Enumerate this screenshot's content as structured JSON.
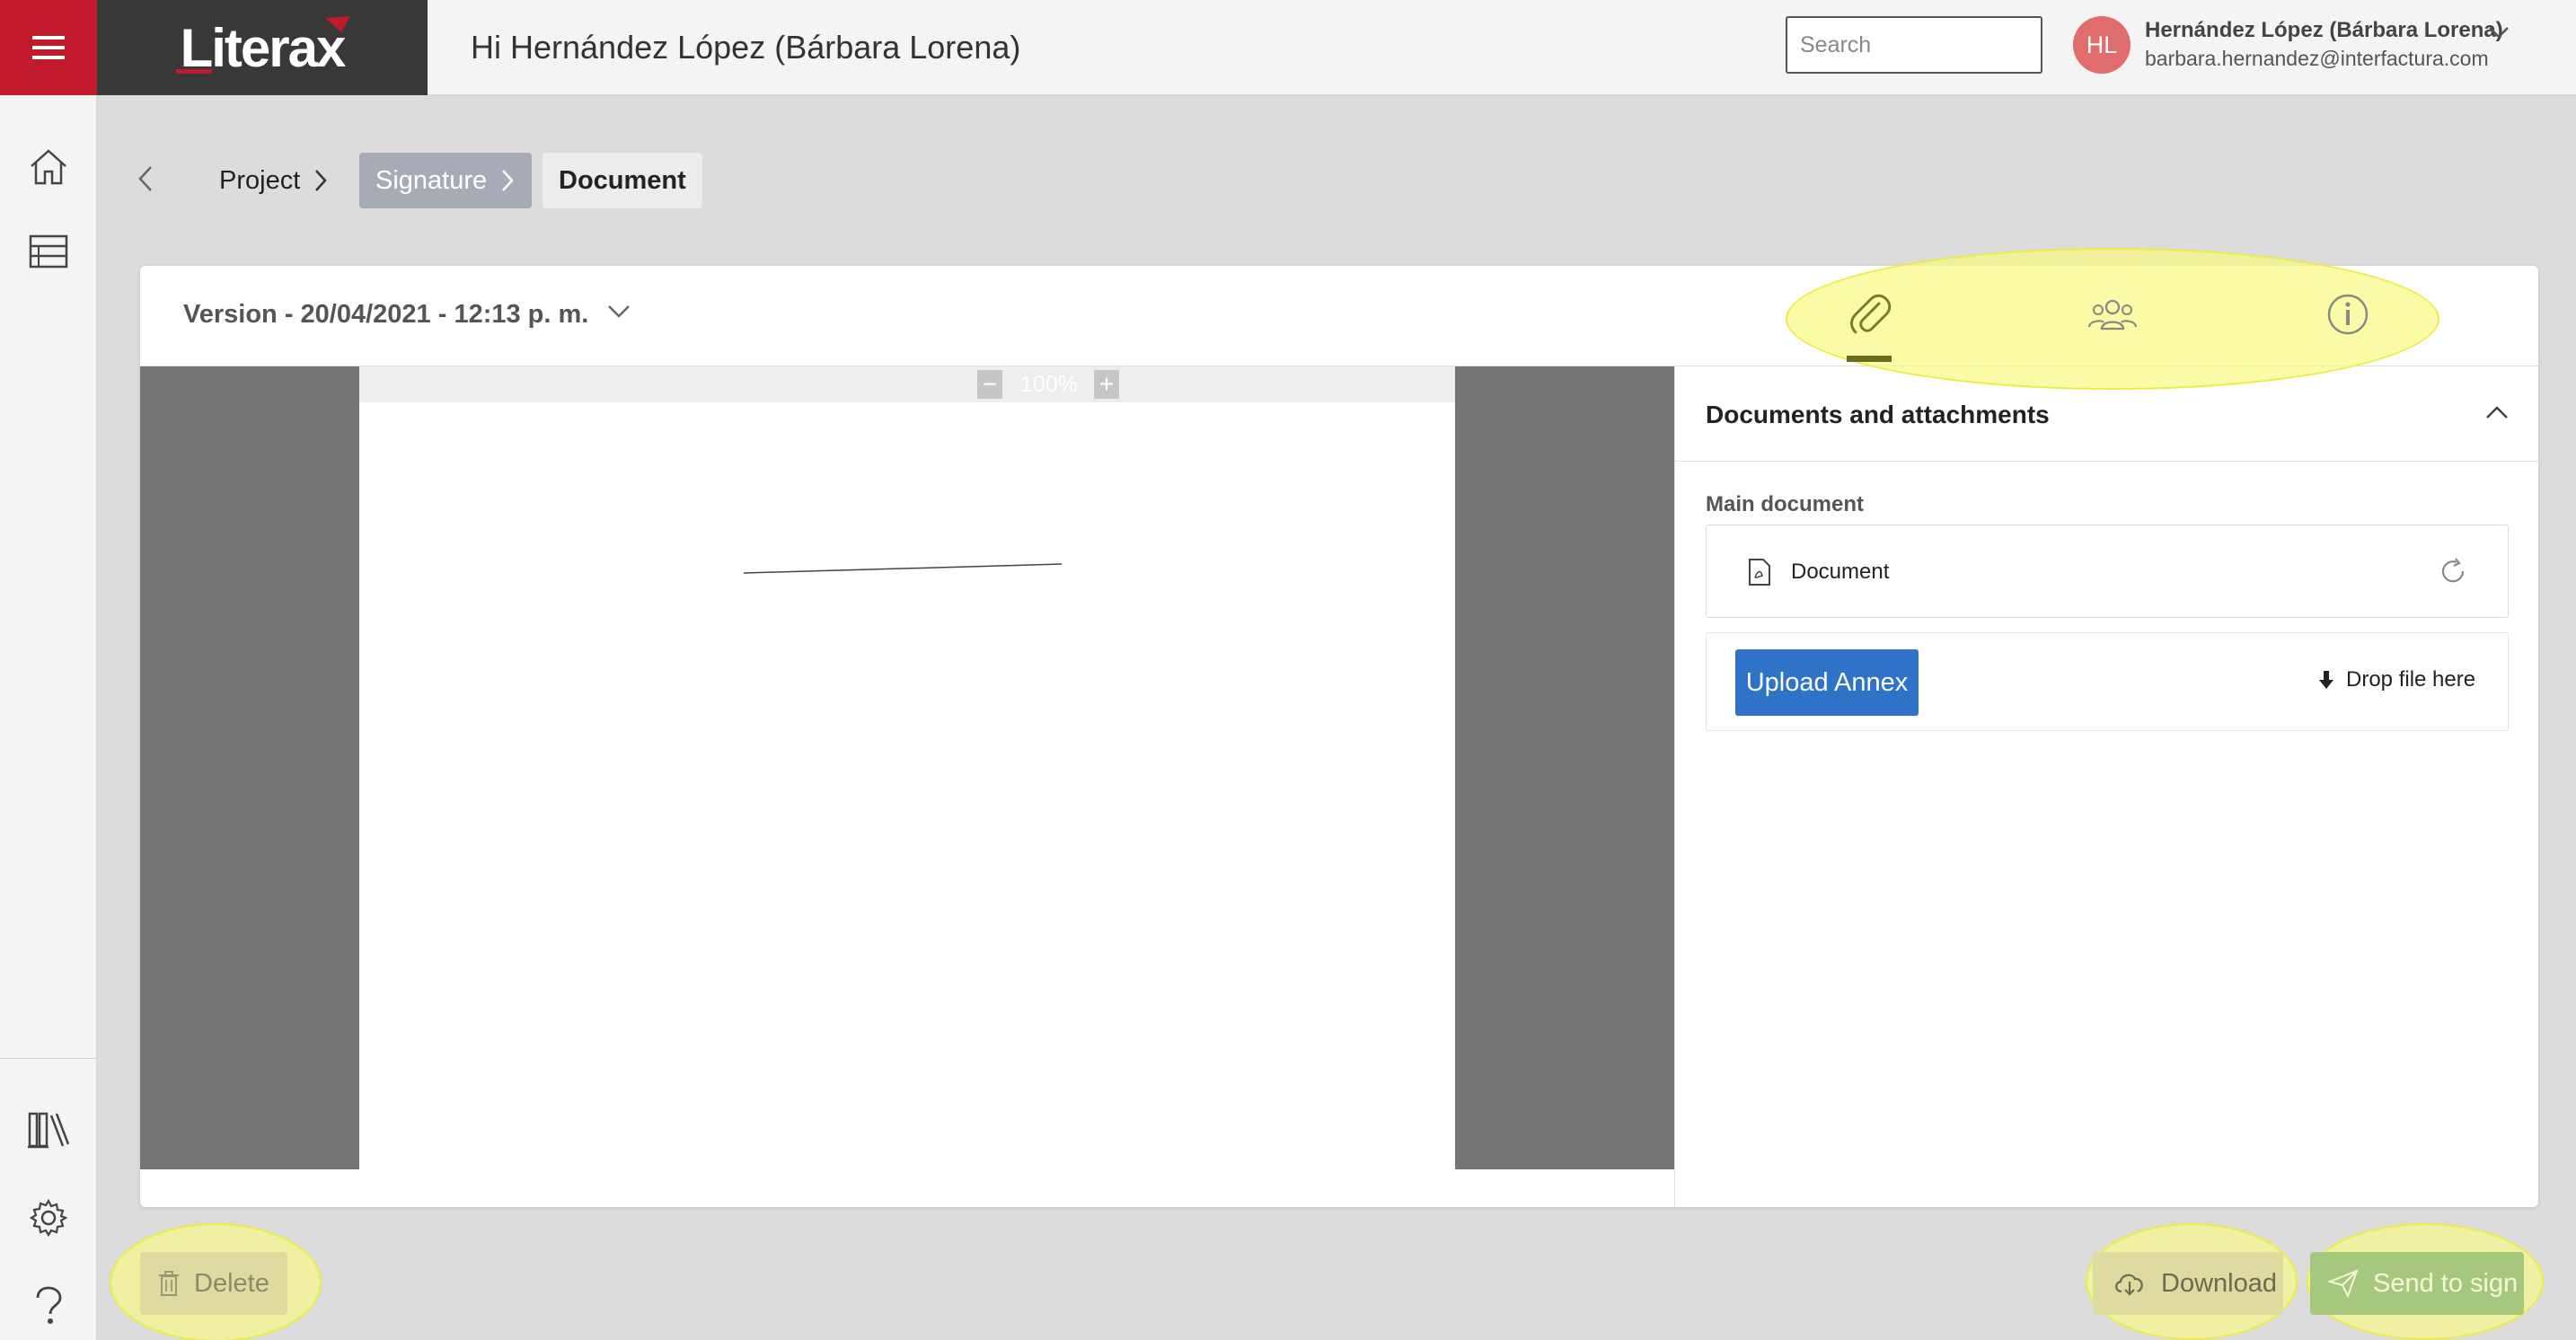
{
  "app": {
    "logo": "Literax",
    "greeting": "Hi Hernández López (Bárbara Lorena)",
    "accent": "#c01a2c"
  },
  "search": {
    "placeholder": "Search",
    "value": "",
    "icon": "search-icon"
  },
  "user": {
    "initials": "HL",
    "name": "Hernández López (Bárbara Lorena)",
    "email": "barbara.hernandez@interfactura.com"
  },
  "sidebar": {
    "items": [
      {
        "icon": "home-icon"
      },
      {
        "icon": "table-icon"
      },
      {
        "icon": "library-icon"
      },
      {
        "icon": "gear-icon"
      },
      {
        "icon": "help-icon"
      }
    ]
  },
  "breadcrumb": {
    "items": [
      "Project",
      "Signature",
      "Document"
    ]
  },
  "version": {
    "label": "Version - 20/04/2021 - 12:13 p. m."
  },
  "tabs": [
    {
      "icon": "paperclip-icon",
      "active": true
    },
    {
      "icon": "group-icon",
      "active": false
    },
    {
      "icon": "info-icon",
      "active": false
    }
  ],
  "viewer": {
    "zoom": "100%",
    "zoom_minus": "−",
    "zoom_plus": "+"
  },
  "panel": {
    "title": "Documents and attachments",
    "main_document_label": "Main document",
    "document_name": "Document",
    "upload_label": "Upload Annex",
    "drop_label": "Drop file here"
  },
  "actions": {
    "delete": "Delete",
    "download": "Download",
    "send": "Send to sign"
  }
}
